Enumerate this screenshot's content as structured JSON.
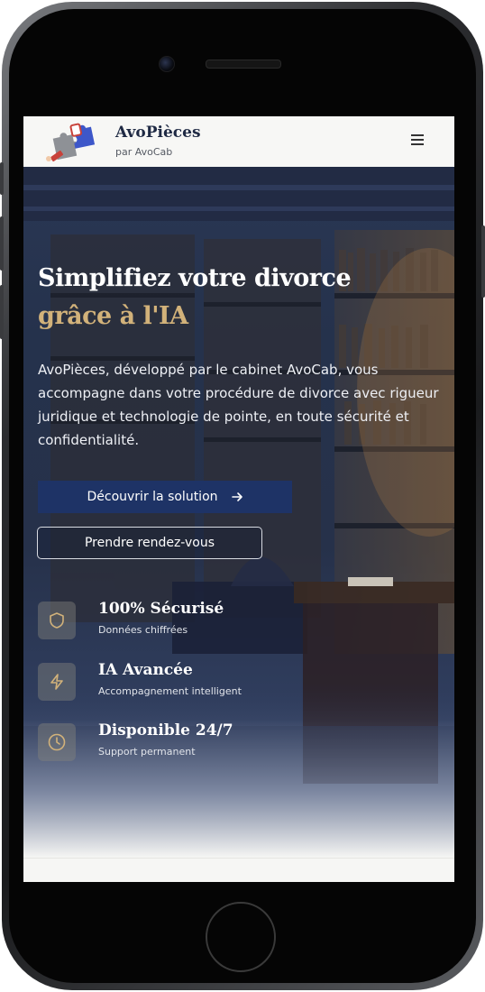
{
  "header": {
    "brand_title": "AvoPièces",
    "brand_subtitle": "par AvoCab",
    "menu_icon": "hamburger-menu-icon"
  },
  "hero": {
    "title_line1": "Simplifiez votre divorce",
    "title_line2": "grâce à l'IA",
    "description": "AvoPièces, développé par le cabinet AvoCab, vous accompagne dans votre procédure de divorce avec rigueur juridique et technologie de pointe, en toute sécurité et confidentialité.",
    "primary_button": "Découvrir la solution",
    "secondary_button": "Prendre rendez-vous",
    "features": [
      {
        "icon": "shield-icon",
        "title": "100% Sécurisé",
        "subtitle": "Données chiffrées"
      },
      {
        "icon": "lightning-icon",
        "title": "IA Avancée",
        "subtitle": "Accompagnement intelligent"
      },
      {
        "icon": "clock-icon",
        "title": "Disponible 24/7",
        "subtitle": "Support permanent"
      }
    ]
  },
  "colors": {
    "navy": "#1e3366",
    "gold": "#d2b27a",
    "header_bg": "#f7f7f5"
  }
}
